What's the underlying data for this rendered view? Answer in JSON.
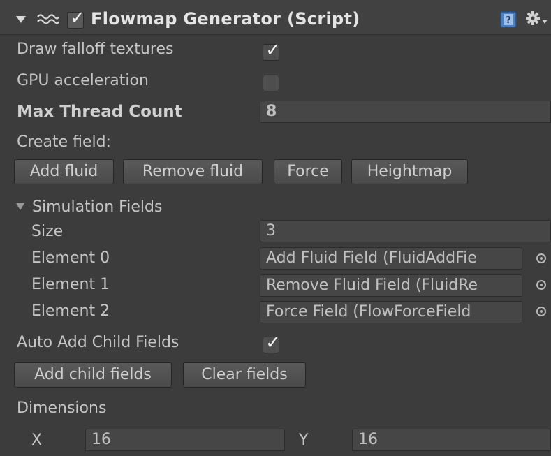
{
  "header": {
    "title": "Flowmap Generator (Script)",
    "enabled_checked": true,
    "icons": [
      "foldout-arrow-icon",
      "script-icon",
      "help-book-icon",
      "gear-icon"
    ]
  },
  "properties": {
    "draw_falloff_label": "Draw falloff textures",
    "draw_falloff_checked": true,
    "gpu_label": "GPU acceleration",
    "gpu_checked": false,
    "max_thread_label": "Max Thread Count",
    "max_thread_value": "8",
    "create_field_label": "Create field:"
  },
  "create_buttons": {
    "add_fluid": "Add fluid",
    "remove_fluid": "Remove fluid",
    "force": "Force",
    "heightmap": "Heightmap"
  },
  "simulation_fields": {
    "label": "Simulation Fields",
    "size_label": "Size",
    "size_value": "3",
    "elements": [
      {
        "label": "Element 0",
        "value": "Add Fluid Field (FluidAddFie"
      },
      {
        "label": "Element 1",
        "value": "Remove Fluid Field (FluidRe"
      },
      {
        "label": "Element 2",
        "value": "Force Field (FlowForceField"
      }
    ]
  },
  "auto_add": {
    "label": "Auto Add Child Fields",
    "checked": true
  },
  "child_buttons": {
    "add_child": "Add child fields",
    "clear": "Clear fields"
  },
  "dimensions": {
    "label": "Dimensions",
    "x_label": "X",
    "x_value": "16",
    "y_label": "Y",
    "y_value": "16"
  },
  "colors": {
    "background": "#3c3c3c",
    "header": "#414141",
    "field": "#464646",
    "text": "#c8c8c8",
    "help_icon": "#4a7fc1"
  }
}
